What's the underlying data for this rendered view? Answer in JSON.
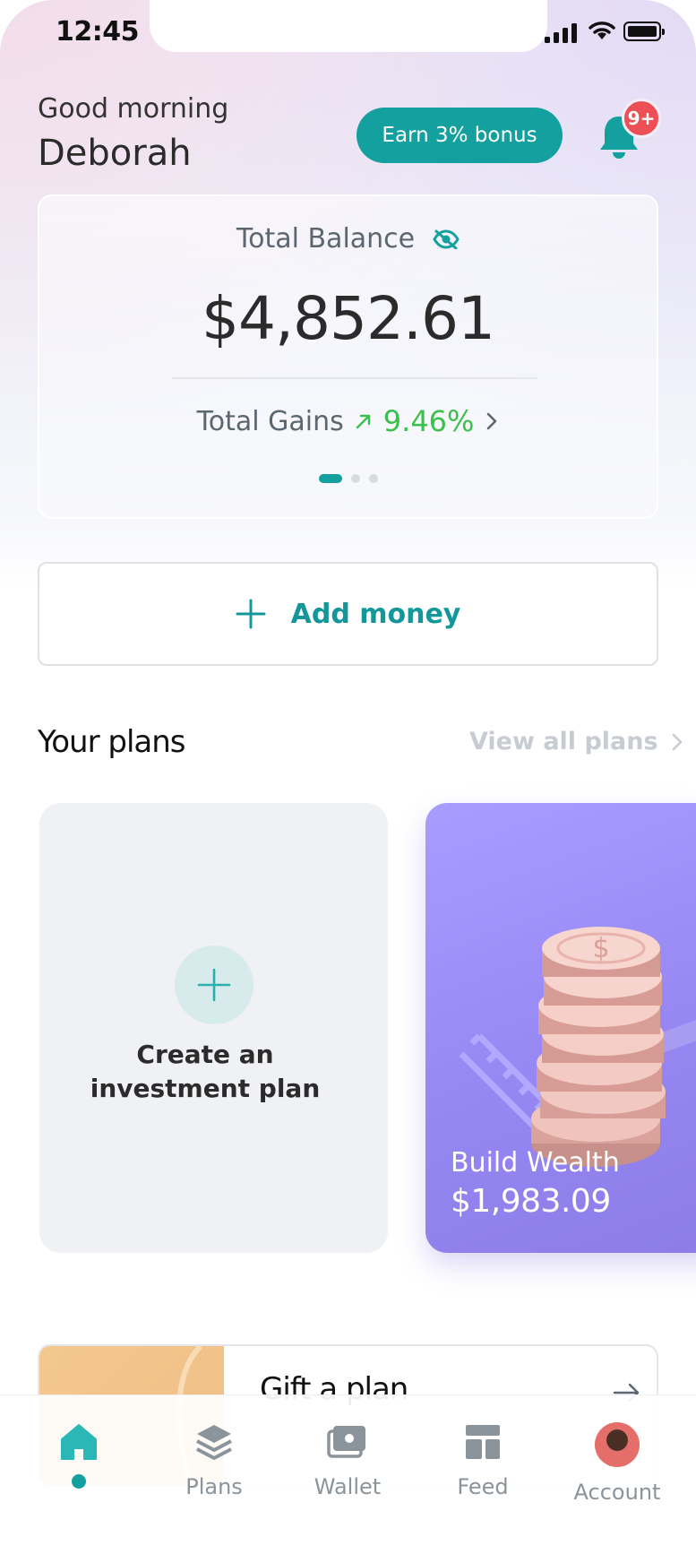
{
  "status_bar": {
    "time": "12:45"
  },
  "header": {
    "greeting": "Good morning",
    "name": "Deborah",
    "bonus_button": "Earn 3% bonus",
    "notification_badge": "9+"
  },
  "balance": {
    "label": "Total Balance",
    "value": "$4,852.61",
    "gains_label": "Total Gains",
    "gains_value": "9.46%",
    "page_count": 3,
    "active_page": 1
  },
  "add_money": {
    "label": "Add money"
  },
  "plans": {
    "title": "Your plans",
    "view_all": "View all plans",
    "create_card": {
      "line1": "Create an",
      "line2": "investment plan"
    },
    "items": [
      {
        "name": "Build Wealth",
        "value": "$1,983.09"
      }
    ]
  },
  "gift": {
    "title": "Gift a plan"
  },
  "tabbar": {
    "items": [
      {
        "label": "",
        "icon": "home-icon"
      },
      {
        "label": "Plans",
        "icon": "layers-icon"
      },
      {
        "label": "Wallet",
        "icon": "wallet-icon"
      },
      {
        "label": "Feed",
        "icon": "feed-icon"
      },
      {
        "label": "Account",
        "icon": "avatar"
      }
    ]
  },
  "colors": {
    "accent": "#14a09f",
    "gain": "#3cc04c",
    "badge": "#ec4f55",
    "wealth_card": "#9a8bf5"
  }
}
